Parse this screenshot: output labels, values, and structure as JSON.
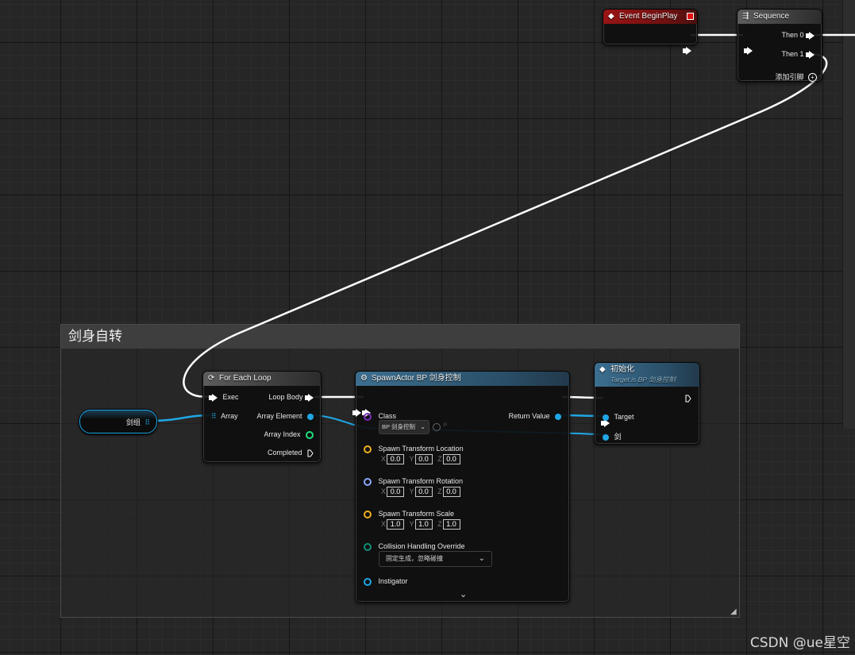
{
  "comment": {
    "title": "剑身自转"
  },
  "event_begin_play": {
    "title": "Event BeginPlay"
  },
  "sequence": {
    "title": "Sequence",
    "then0": "Then 0",
    "then1": "Then 1",
    "add_pin": "添加引脚"
  },
  "variable_node": {
    "label": "剑组"
  },
  "for_each": {
    "title": "For Each Loop",
    "exec": "Exec",
    "array": "Array",
    "loop_body": "Loop Body",
    "array_element": "Array Element",
    "array_index": "Array Index",
    "completed": "Completed"
  },
  "spawn_actor": {
    "title": "SpawnActor BP 剑身控制",
    "class_label": "Class",
    "class_value": "BP 剑身控制",
    "return_value": "Return Value",
    "location_label": "Spawn Transform Location",
    "location": {
      "x": "0.0",
      "y": "0.0",
      "z": "0.0"
    },
    "rotation_label": "Spawn Transform Rotation",
    "rotation": {
      "x": "0.0",
      "y": "0.0",
      "z": "0.0"
    },
    "scale_label": "Spawn Transform Scale",
    "scale": {
      "x": "1.0",
      "y": "1.0",
      "z": "1.0"
    },
    "collision_label": "Collision Handling Override",
    "collision_value": "固定生成，忽略碰撞",
    "instigator": "Instigator",
    "axis_x": "X",
    "axis_y": "Y",
    "axis_z": "Z"
  },
  "init_node": {
    "title": "初始化",
    "subtitle": "Target is BP 剑身控制",
    "target": "Target",
    "sword": "剑"
  },
  "watermark": "CSDN @ue星空",
  "colors": {
    "exec": "#ffffff",
    "object_pin": "#1fa7e5",
    "int_pin": "#1fe07f",
    "vector_pin": "#f0b020",
    "rotator_pin": "#8aa8ff",
    "class_pin": "#7b2cbf",
    "event_header": "#9a1515",
    "function_header": "#3c6f90"
  }
}
